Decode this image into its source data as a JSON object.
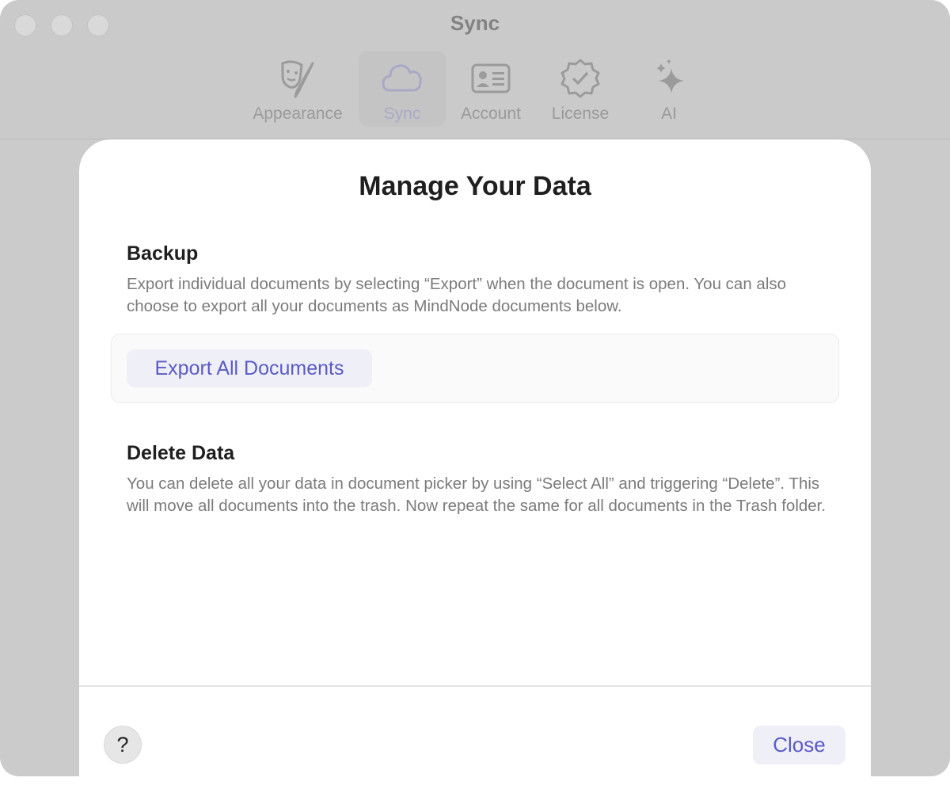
{
  "window": {
    "title": "Sync"
  },
  "tabs": [
    {
      "label": "Appearance",
      "icon": "theater-masks-icon",
      "active": false
    },
    {
      "label": "Sync",
      "icon": "cloud-icon",
      "active": true
    },
    {
      "label": "Account",
      "icon": "contact-card-icon",
      "active": false
    },
    {
      "label": "License",
      "icon": "verified-badge-icon",
      "active": false
    },
    {
      "label": "AI",
      "icon": "sparkles-icon",
      "active": false
    }
  ],
  "sheet": {
    "title": "Manage Your Data",
    "backup": {
      "title": "Backup",
      "description": "Export individual documents by selecting “Export” when the document is open. You can also choose to export all your documents as MindNode documents below.",
      "button_label": "Export All Documents"
    },
    "delete": {
      "title": "Delete Data",
      "description": "You can delete all your data in document picker by using “Select All” and triggering “Delete”. This will move all documents into the trash. Now repeat the same for all documents in the Trash folder."
    },
    "help_label": "?",
    "close_label": "Close"
  },
  "colors": {
    "accent": "#5b5bc6",
    "button_bg": "#efeff8",
    "window_bg": "#cbcbcb"
  }
}
